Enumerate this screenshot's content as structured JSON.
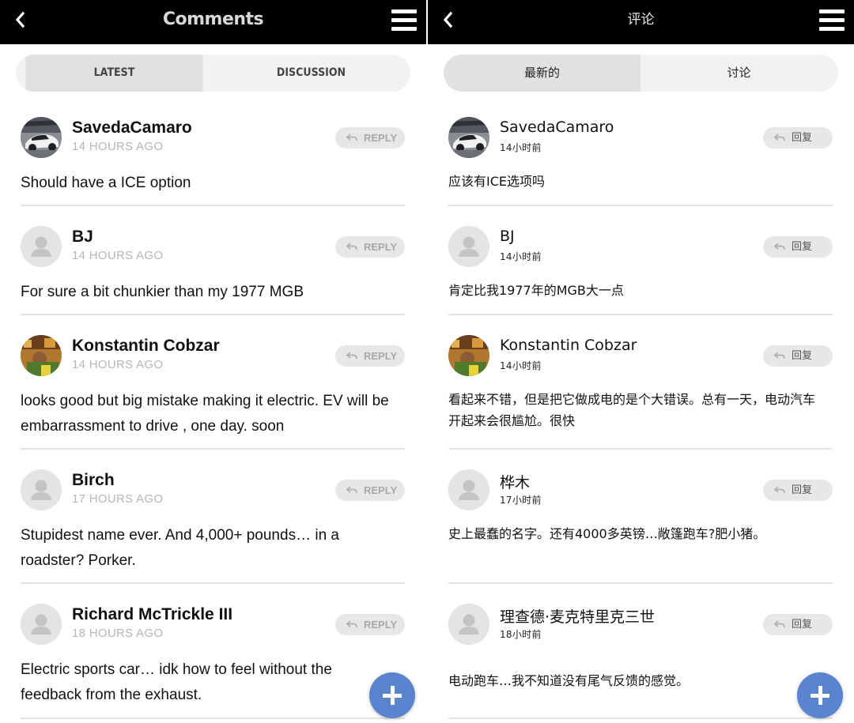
{
  "left": {
    "header": {
      "title": "Comments"
    },
    "tabs": {
      "latest": "LATEST",
      "discussion": "DISCUSSION"
    },
    "reply_label": "REPLY",
    "comments": [
      {
        "name": "SavedaCamaro",
        "time": "14 HOURS AGO",
        "text": "Should have a ICE option"
      },
      {
        "name": "BJ",
        "time": "14 HOURS AGO",
        "text": "For sure a bit chunkier than my 1977 MGB"
      },
      {
        "name": "Konstantin Cobzar",
        "time": "14 HOURS AGO",
        "text": "looks good but big mistake making it electric. EV will be embarrassment to drive , one day. soon"
      },
      {
        "name": "Birch",
        "time": "17 HOURS AGO",
        "text": "Stupidest name ever. And 4,000+ pounds… in a roadster? Porker."
      },
      {
        "name": "Richard McTrickle III",
        "time": "18 HOURS AGO",
        "text": "Electric sports car… idk how to feel without the feedback from the exhaust."
      }
    ]
  },
  "right": {
    "header": {
      "title": "评论"
    },
    "tabs": {
      "latest": "最新的",
      "discussion": "讨论"
    },
    "reply_label": "回复",
    "comments": [
      {
        "name": "SavedaCamaro",
        "time": "14小时前",
        "text": "应该有ICE选项吗"
      },
      {
        "name": "BJ",
        "time": "14小时前",
        "text": "肯定比我1977年的MGB大一点"
      },
      {
        "name": "Konstantin Cobzar",
        "time": "14小时前",
        "text": "看起来不错，但是把它做成电的是个大错误。总有一天，电动汽车开起来会很尴尬。很快"
      },
      {
        "name": "桦木",
        "time": "17小时前",
        "text": "史上最蠢的名字。还有4000多英镑…敞篷跑车?肥小猪。"
      },
      {
        "name": "理查德·麦克特里克三世",
        "time": "18小时前",
        "text": "电动跑车…我不知道没有尾气反馈的感觉。"
      }
    ]
  },
  "icons": {
    "back": "chevron-left-icon",
    "menu": "hamburger-menu-icon",
    "reply": "reply-arrow-icon",
    "add": "plus-icon",
    "avatar_default": "user-silhouette-icon"
  },
  "colors": {
    "topbar": "#000000",
    "fab": "#5b84cf",
    "tab_active": "#e1e1e1",
    "tab_inactive": "#f2f2f2",
    "divider": "#e3e3e3"
  }
}
